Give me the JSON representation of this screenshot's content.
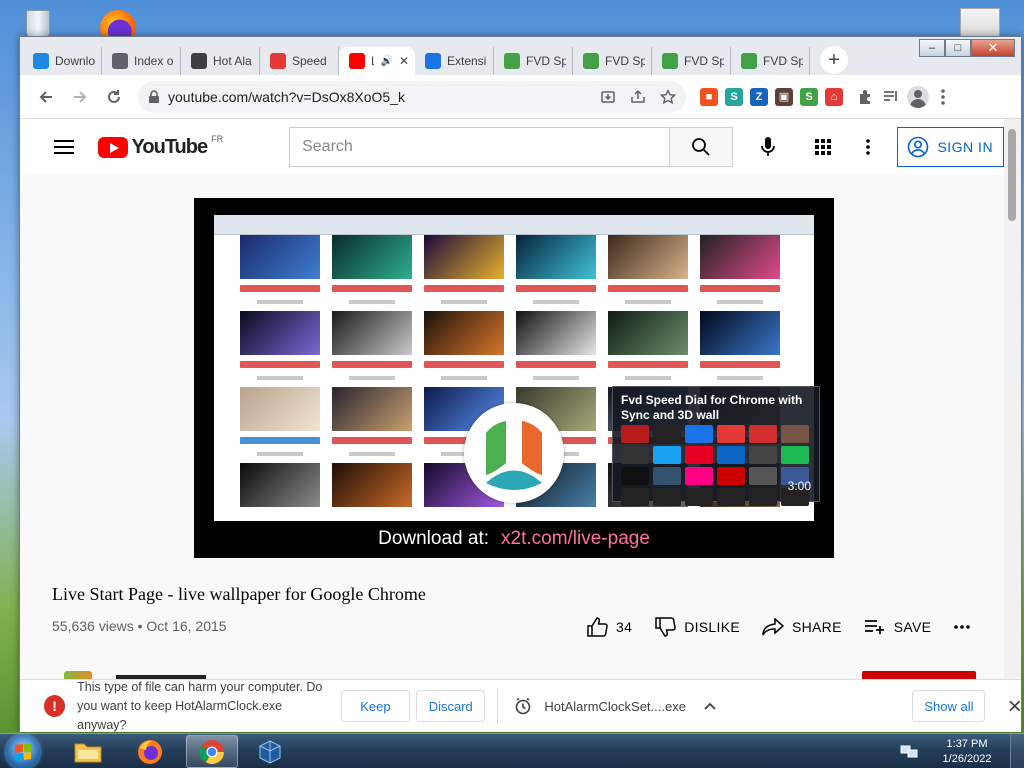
{
  "window": {
    "controls": {
      "minimize": "‒",
      "maximize": "□",
      "close": "✕"
    }
  },
  "tabs": [
    {
      "label": "Downlo",
      "favicon": "chart-icon",
      "color": "#1e88e5"
    },
    {
      "label": "Index o",
      "favicon": "globe-icon",
      "color": "#5f6368"
    },
    {
      "label": "Hot Ala",
      "favicon": "clock-icon",
      "color": "#3c4043"
    },
    {
      "label": "Speed",
      "favicon": "speed-icon",
      "color": "#e53935"
    },
    {
      "label": "L",
      "favicon": "youtube-icon",
      "color": "#ff0000",
      "active": true
    },
    {
      "label": "Extensi",
      "favicon": "puzzle-icon",
      "color": "#1a73e8"
    },
    {
      "label": "FVD Sp",
      "favicon": "house-icon",
      "color": "#43a047"
    },
    {
      "label": "FVD Sp",
      "favicon": "house-icon",
      "color": "#43a047"
    },
    {
      "label": "FVD Sp",
      "favicon": "house-icon",
      "color": "#43a047"
    },
    {
      "label": "FVD Sp",
      "favicon": "house-icon",
      "color": "#43a047"
    }
  ],
  "toolbar": {
    "url": "youtube.com/watch?v=DsOx8XoO5_k",
    "extensions": [
      {
        "name": "toolbox-extension-icon",
        "glyph": "■",
        "color": "#f4511e"
      },
      {
        "name": "s-extension-icon",
        "glyph": "S",
        "color": "#26a69a"
      },
      {
        "name": "z-extension-icon",
        "glyph": "Z",
        "color": "#1565c0"
      },
      {
        "name": "gallery-extension-icon",
        "glyph": "▣",
        "color": "#5d4037"
      },
      {
        "name": "s2-extension-icon",
        "glyph": "S",
        "color": "#43a047"
      },
      {
        "name": "fvd-extension-icon",
        "glyph": "⌂",
        "color": "#e53935"
      }
    ]
  },
  "youtube": {
    "logo_text": "YouTube",
    "country": "FR",
    "search_placeholder": "Search",
    "sign_in": "SIGN IN",
    "video": {
      "download_prefix": "Download at:",
      "download_link": "x2t.com/live-page",
      "popup_title": "Fvd Speed Dial for Chrome with Sync and 3D wall",
      "popup_timer": "3:00"
    },
    "title": "Live Start Page - live wallpaper for Google Chrome",
    "views": "55,636 views",
    "date": "Oct 16, 2015",
    "likes": "34",
    "dislike": "DISLIKE",
    "share": "SHARE",
    "save": "SAVE"
  },
  "download_shelf": {
    "warning": "This type of file can harm your computer. Do you want to keep HotAlarmClock.exe anyway?",
    "keep": "Keep",
    "discard": "Discard",
    "filename": "HotAlarmClockSet....exe",
    "show_all": "Show all"
  },
  "taskbar": {
    "time": "1:37 PM",
    "date": "1/26/2022"
  },
  "colors": {
    "youtube_red": "#ff0000",
    "link_blue": "#065fd4",
    "chrome_blue": "#1a73e8",
    "warning_red": "#d93025"
  }
}
